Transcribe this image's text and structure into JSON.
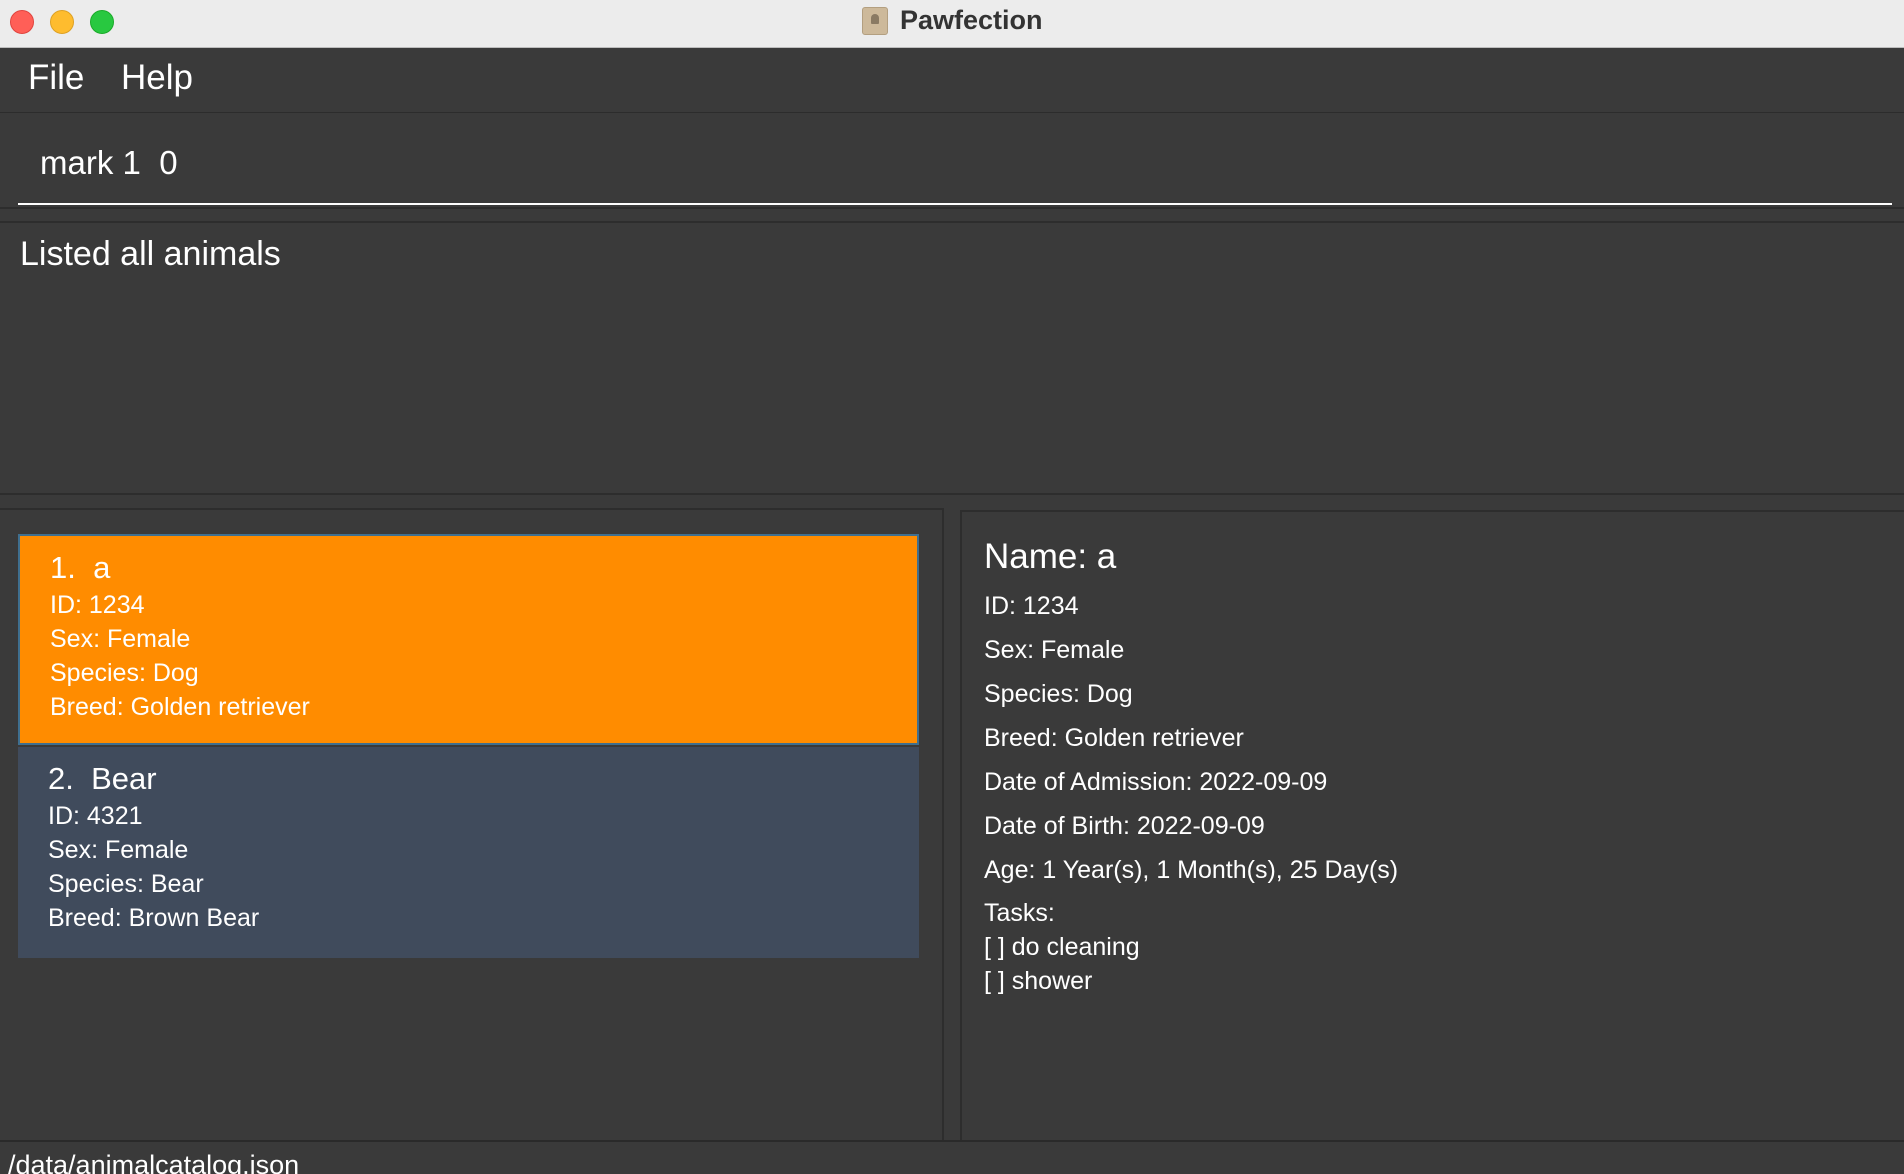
{
  "window": {
    "title": "Pawfection"
  },
  "menu": {
    "file": "File",
    "help": "Help"
  },
  "command": {
    "value": "mark 1  0"
  },
  "result": {
    "text": "Listed all animals"
  },
  "animals": [
    {
      "title": "1.  a",
      "id": "ID: 1234",
      "sex": "Sex: Female",
      "species": "Species: Dog",
      "breed": "Breed: Golden retriever",
      "selected": true
    },
    {
      "title": "2.  Bear",
      "id": "ID: 4321",
      "sex": "Sex: Female",
      "species": "Species: Bear",
      "breed": "Breed: Brown Bear",
      "selected": false
    }
  ],
  "detail": {
    "name": "Name: a",
    "id": "ID: 1234",
    "sex": "Sex: Female",
    "species": "Species: Dog",
    "breed": "Breed: Golden retriever",
    "admission": "Date of Admission: 2022-09-09",
    "birth": "Date of Birth: 2022-09-09",
    "age": "Age: 1 Year(s), 1 Month(s), 25 Day(s)",
    "tasks_label": "Tasks:",
    "tasks": [
      "[ ] do cleaning",
      "[ ] shower"
    ]
  },
  "status": {
    "path": "/data/animalcatalog.json"
  },
  "colors": {
    "selected_card": "#ff8c00",
    "card": "#404b5c",
    "background": "#3a3a3a"
  },
  "icons": {
    "app": "app-icon"
  }
}
